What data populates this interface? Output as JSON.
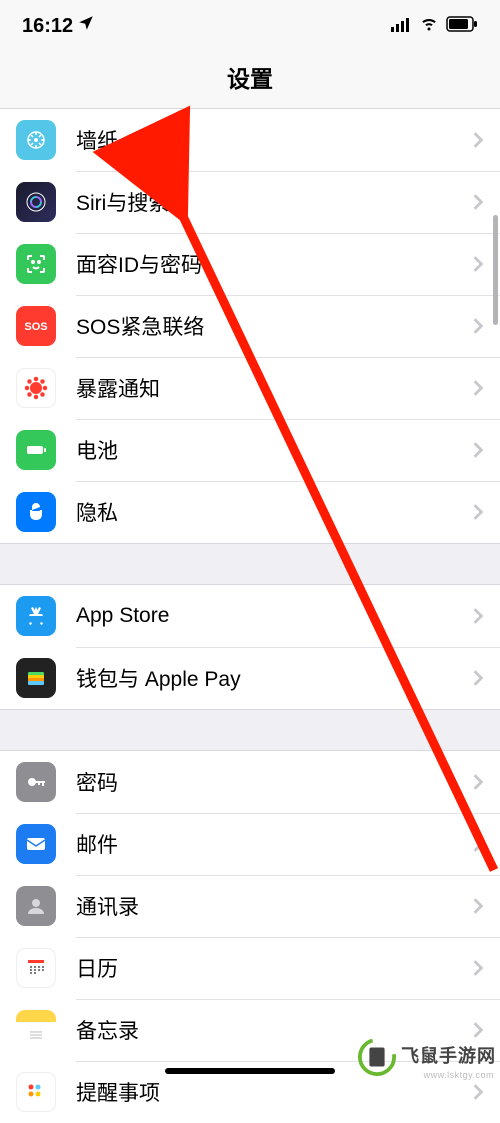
{
  "status": {
    "time": "16:12"
  },
  "header": {
    "title": "设置"
  },
  "groups": [
    {
      "items": [
        {
          "key": "wallpaper",
          "label": "墙纸",
          "iconClass": "bg-wallpaper",
          "iconName": "wallpaper-icon"
        },
        {
          "key": "siri",
          "label": "Siri与搜索",
          "iconClass": "bg-siri",
          "iconName": "siri-icon"
        },
        {
          "key": "faceid",
          "label": "面容ID与密码",
          "iconClass": "bg-faceid",
          "iconName": "faceid-icon"
        },
        {
          "key": "sos",
          "label": "SOS紧急联络",
          "iconClass": "bg-sos",
          "iconName": "sos-icon"
        },
        {
          "key": "exposure",
          "label": "暴露通知",
          "iconClass": "bg-exposure",
          "iconName": "exposure-icon"
        },
        {
          "key": "battery",
          "label": "电池",
          "iconClass": "bg-battery",
          "iconName": "battery-icon"
        },
        {
          "key": "privacy",
          "label": "隐私",
          "iconClass": "bg-privacy",
          "iconName": "privacy-icon"
        }
      ]
    },
    {
      "items": [
        {
          "key": "appstore",
          "label": "App Store",
          "iconClass": "bg-appstore",
          "iconName": "appstore-icon"
        },
        {
          "key": "wallet",
          "label": "钱包与 Apple Pay",
          "iconClass": "bg-wallet",
          "iconName": "wallet-icon"
        }
      ]
    },
    {
      "items": [
        {
          "key": "passwords",
          "label": "密码",
          "iconClass": "bg-passwords",
          "iconName": "passwords-icon"
        },
        {
          "key": "mail",
          "label": "邮件",
          "iconClass": "bg-mail",
          "iconName": "mail-icon"
        },
        {
          "key": "contacts",
          "label": "通讯录",
          "iconClass": "bg-contacts",
          "iconName": "contacts-icon"
        },
        {
          "key": "calendar",
          "label": "日历",
          "iconClass": "bg-calendar",
          "iconName": "calendar-icon"
        },
        {
          "key": "notes",
          "label": "备忘录",
          "iconClass": "bg-notes",
          "iconName": "notes-icon"
        },
        {
          "key": "reminders",
          "label": "提醒事项",
          "iconClass": "bg-reminders",
          "iconName": "reminders-icon"
        }
      ]
    }
  ],
  "watermark": {
    "text": "飞鼠手游网",
    "sub": "www.lsktgy.com"
  }
}
